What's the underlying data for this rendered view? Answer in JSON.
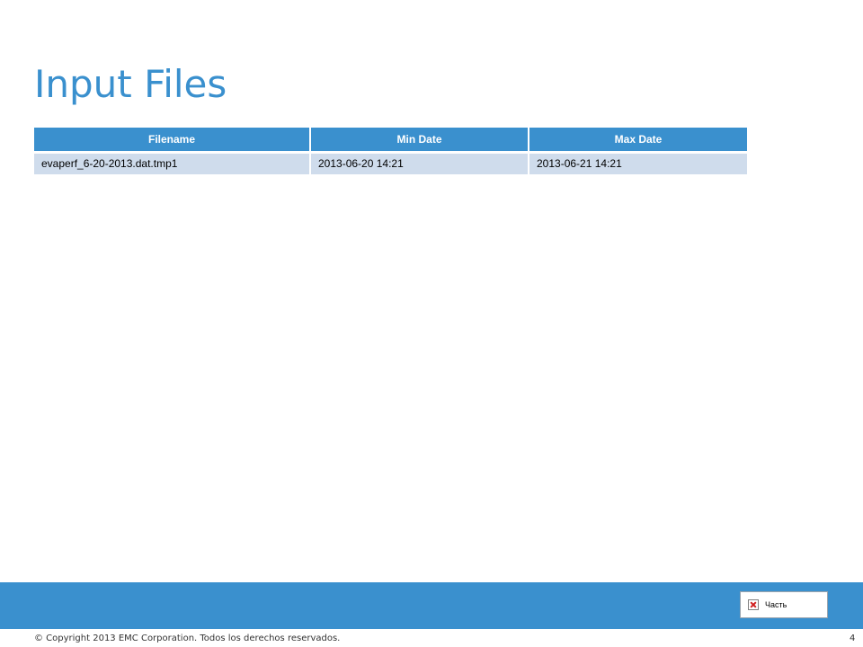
{
  "slide": {
    "title": "Input Files",
    "page_number": "4",
    "copyright": "© Copyright 2013 EMC Corporation. Todos los derechos reservados."
  },
  "table": {
    "headers": [
      "Filename",
      "Min Date",
      "Max Date"
    ],
    "rows": [
      [
        "evaperf_6-20-2013.dat.tmp1",
        "2013-06-20 14:21",
        "2013-06-21 14:21"
      ]
    ]
  },
  "placeholder_image": {
    "label": "Часть",
    "icon": "broken-image-icon"
  },
  "colors": {
    "accent": "#3a90ce",
    "row_fill": "#cfdcec",
    "text": "#000000"
  }
}
